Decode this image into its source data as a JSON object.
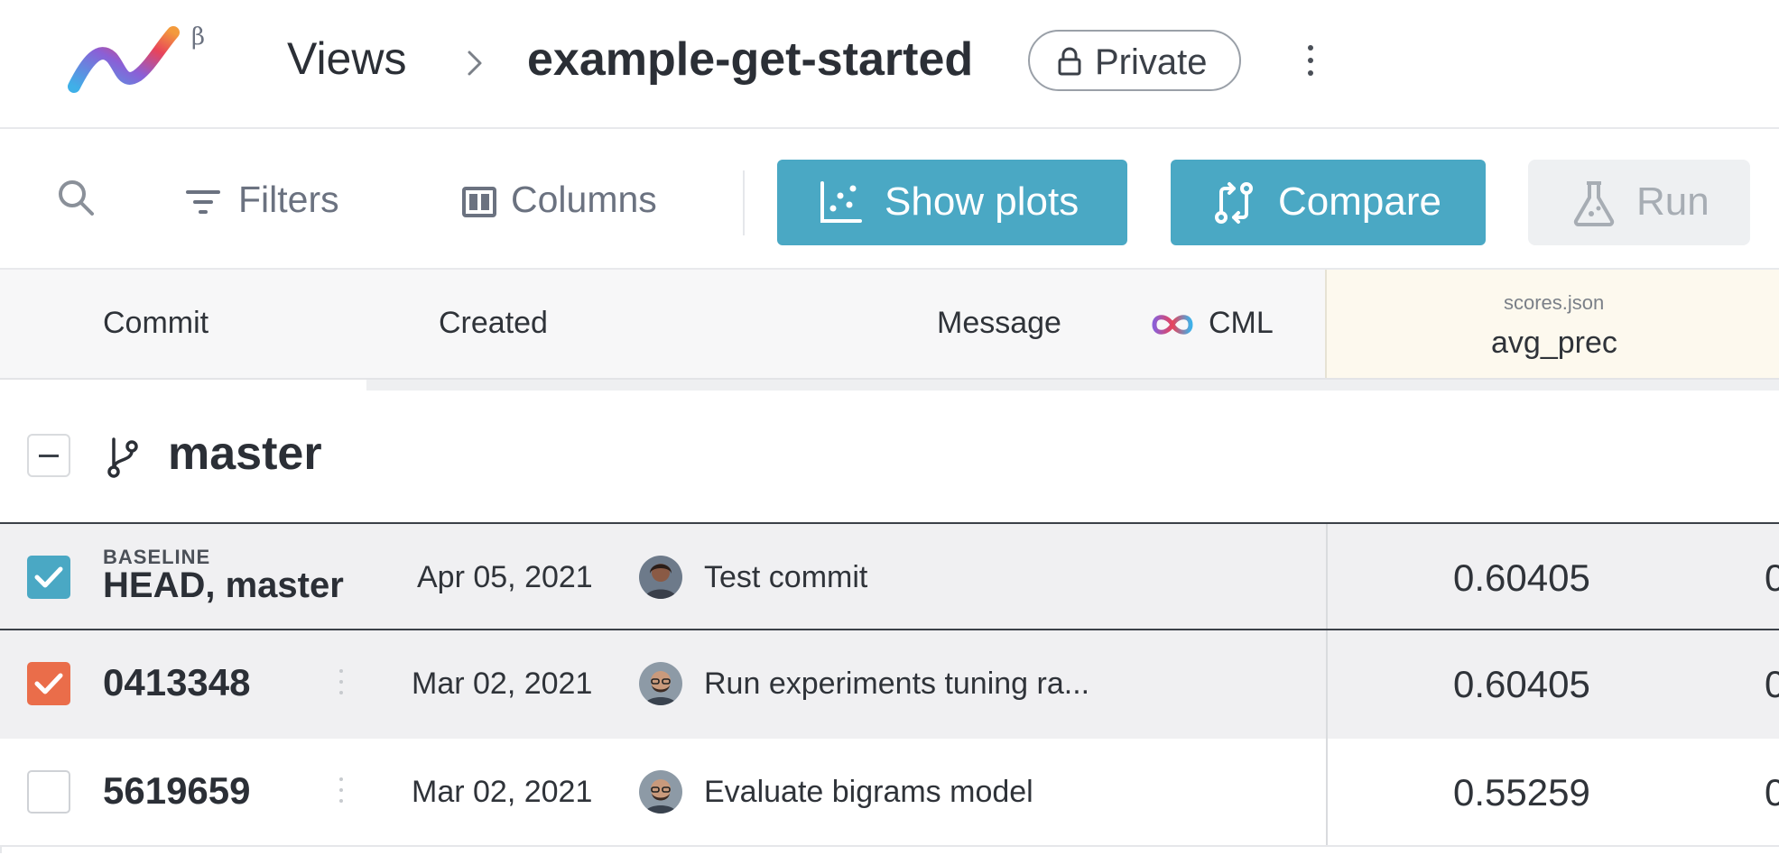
{
  "header": {
    "beta_symbol": "β",
    "crumb_root": "Views",
    "project": "example-get-started",
    "visibility": "Private"
  },
  "toolbar": {
    "filters_label": "Filters",
    "columns_label": "Columns",
    "show_plots_label": "Show plots",
    "compare_label": "Compare",
    "run_label": "Run"
  },
  "table": {
    "columns": {
      "commit": "Commit",
      "created": "Created",
      "message": "Message",
      "cml": "CML",
      "metric_file": "scores.json",
      "metric_name": "avg_prec"
    },
    "branch": "master",
    "rows": [
      {
        "tag": "BASELINE",
        "commit": "HEAD, master",
        "created": "Apr 05, 2021",
        "message": "Test commit",
        "avg_prec": "0.60405",
        "next_col_partial": "0",
        "checked": true,
        "check_color": "#4aa8c4"
      },
      {
        "commit": "0413348",
        "created": "Mar 02, 2021",
        "message": "Run experiments tuning ra...",
        "avg_prec": "0.60405",
        "next_col_partial": "0",
        "checked": true,
        "check_color": "#ea6d4a"
      },
      {
        "commit": "5619659",
        "created": "Mar 02, 2021",
        "message": "Evaluate bigrams model",
        "avg_prec": "0.55259",
        "next_col_partial": "0",
        "checked": false
      }
    ]
  },
  "colors": {
    "accent": "#4aa8c4",
    "selected_orange": "#ea6d4a",
    "metric_header_bg": "#fdf9ee"
  }
}
